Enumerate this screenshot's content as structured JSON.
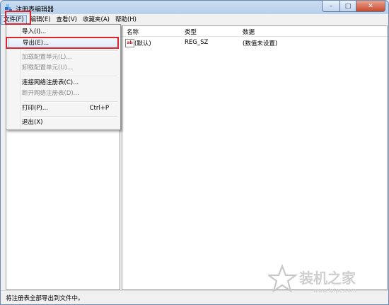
{
  "window": {
    "title": "注册表编辑器"
  },
  "menubar": {
    "items": [
      {
        "label": "文件(F)"
      },
      {
        "label": "编辑(E)"
      },
      {
        "label": "查看(V)"
      },
      {
        "label": "收藏夹(A)"
      },
      {
        "label": "帮助(H)"
      }
    ]
  },
  "file_menu": {
    "items": [
      {
        "label": "导入(I)...",
        "shortcut": "",
        "enabled": true
      },
      {
        "label": "导出(E)...",
        "shortcut": "",
        "enabled": true,
        "highlighted": true
      },
      {
        "label": "加载配置单元(L)...",
        "shortcut": "",
        "enabled": false
      },
      {
        "label": "卸载配置单元(U)...",
        "shortcut": "",
        "enabled": false
      },
      {
        "label": "连接网络注册表(C)...",
        "shortcut": "",
        "enabled": true
      },
      {
        "label": "断开网络注册表(D)...",
        "shortcut": "",
        "enabled": false
      },
      {
        "label": "打印(P)...",
        "shortcut": "Ctrl+P",
        "enabled": true
      },
      {
        "label": "退出(X)",
        "shortcut": "",
        "enabled": true
      }
    ]
  },
  "value_list": {
    "columns": [
      "名称",
      "类型",
      "数据"
    ],
    "rows": [
      {
        "icon": "string-value-icon",
        "icon_text": "ab",
        "name": "(默认)",
        "type": "REG_SZ",
        "data": "(数值未设置)"
      }
    ]
  },
  "status_bar": {
    "text": "将注册表全部导出到文件中。"
  },
  "watermark": {
    "brand": "装机之家",
    "url": "www.lotpc.com"
  },
  "colors": {
    "highlight_border": "#d9262a",
    "title_bar": "#c9dcf2",
    "close_button": "#c8482d"
  }
}
